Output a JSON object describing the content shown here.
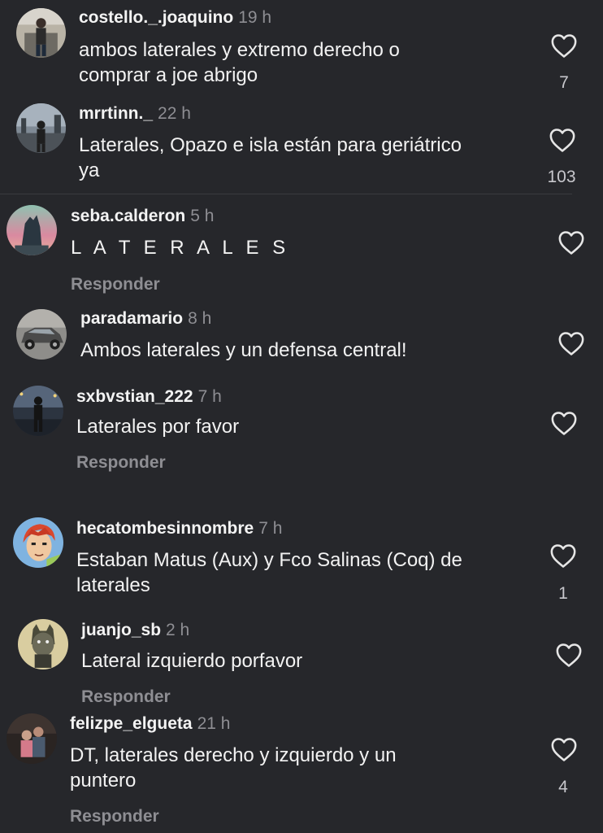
{
  "comments": [
    {
      "username": "costello._.joaquino",
      "time": "19 h",
      "lines": [
        "ambos laterales y extremo derecho o",
        "comprar a joe abrigo"
      ],
      "likes": "7",
      "avatar_icon": "person-standing-photo"
    },
    {
      "username": "mrrtinn._",
      "time": "22 h",
      "lines": [
        "Laterales, Opazo e isla están para geriátrico",
        "ya"
      ],
      "likes": "103",
      "avatar_icon": "person-city-night-photo"
    },
    {
      "username": "seba.calderon",
      "time": "5 h",
      "lines": [
        "L A T E R A L E S"
      ],
      "reply": "Responder",
      "avatar_icon": "statue-sunset-photo"
    },
    {
      "username": "paradamario",
      "time": "8 h",
      "lines": [
        "Ambos laterales y un defensa central!"
      ],
      "avatar_icon": "car-photo"
    },
    {
      "username": "sxbvstian_222",
      "time": "7 h",
      "lines": [
        "Laterales por favor"
      ],
      "reply": "Responder",
      "avatar_icon": "person-night-street-photo"
    },
    {
      "username": "hecatombesinnombre",
      "time": "7 h",
      "lines": [
        "Estaban Matus (Aux) y Fco Salinas (Coq) de",
        "laterales"
      ],
      "likes": "1",
      "avatar_icon": "anime-character-avatar"
    },
    {
      "username": "juanjo_sb",
      "time": "2 h",
      "lines": [
        "Lateral izquierdo porfavor"
      ],
      "reply": "Responder",
      "avatar_icon": "cartoon-character-avatar"
    },
    {
      "username": "felizpe_elgueta",
      "time": "21 h",
      "lines": [
        "DT, laterales derecho y izquierdo y un",
        "puntero"
      ],
      "likes": "4",
      "reply": "Responder",
      "avatar_icon": "couple-photo"
    }
  ],
  "colors": {
    "background": "#26272b",
    "username": "#f3f3f3",
    "secondary_text": "#8e8e93",
    "icon": "#e6e6e6"
  }
}
